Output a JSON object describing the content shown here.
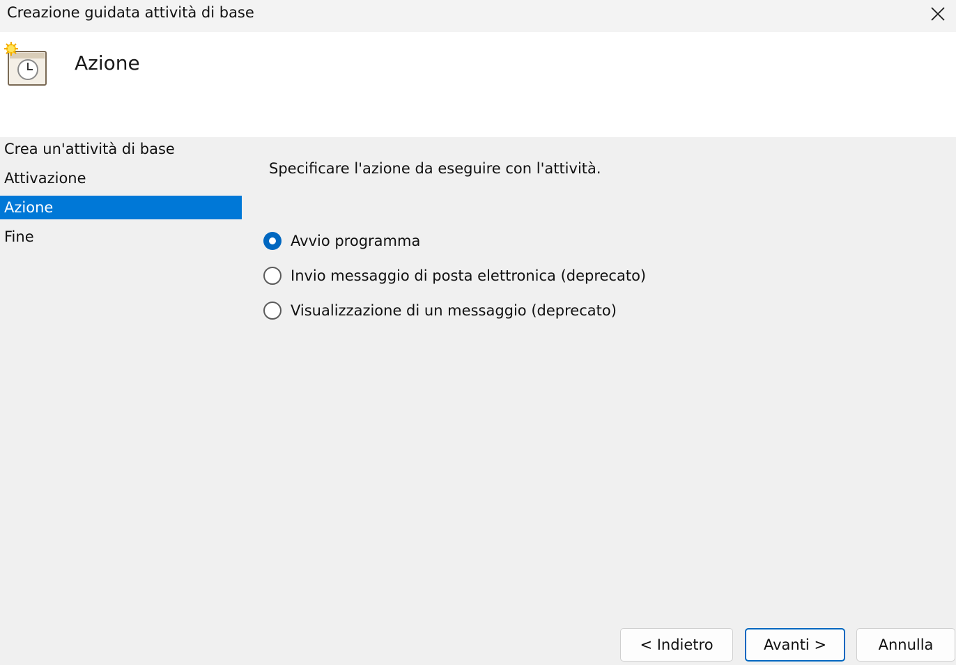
{
  "window": {
    "title": "Creazione guidata attività di base",
    "close_icon": "close-icon"
  },
  "header": {
    "title": "Azione",
    "icon": "task-scheduler-clock-icon"
  },
  "steps": [
    {
      "label": "Crea un'attività di base",
      "active": false
    },
    {
      "label": "Attivazione",
      "active": false
    },
    {
      "label": "Azione",
      "active": true
    },
    {
      "label": "Fine",
      "active": false
    }
  ],
  "content": {
    "instruction": "Specificare l'azione da eseguire con l'attività.",
    "options": [
      {
        "label": "Avvio programma",
        "checked": true
      },
      {
        "label": "Invio messaggio di posta elettronica (deprecato)",
        "checked": false
      },
      {
        "label": "Visualizzazione di un messaggio (deprecato)",
        "checked": false
      }
    ]
  },
  "buttons": {
    "back": "< Indietro",
    "next": "Avanti >",
    "cancel": "Annulla"
  },
  "colors": {
    "selection": "#0078d7",
    "accent": "#0067c0"
  }
}
